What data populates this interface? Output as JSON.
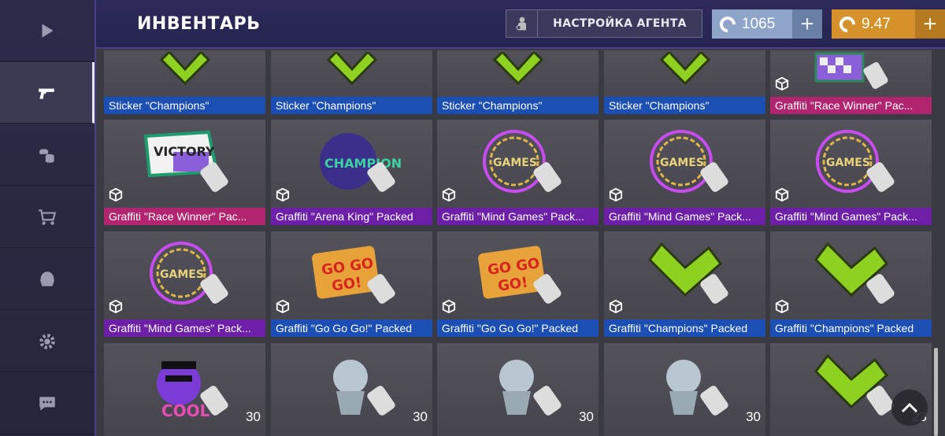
{
  "header": {
    "title": "ИНВЕНТАРЬ",
    "agent_button": "НАСТРОЙКА АГЕНТА",
    "credits": "1065",
    "gold": "9.47",
    "plus": "+"
  },
  "sidebar": {
    "items": [
      {
        "icon": "play-icon"
      },
      {
        "icon": "pistol-icon",
        "active": true
      },
      {
        "icon": "coins-icon"
      },
      {
        "icon": "cart-icon"
      },
      {
        "icon": "helmet-icon"
      },
      {
        "icon": "gear-icon"
      },
      {
        "icon": "chat-icon"
      }
    ]
  },
  "inventory": {
    "rows": [
      [
        {
          "label": "Sticker \"Champions\"",
          "color": "#1c4fb3"
        },
        {
          "label": "Sticker \"Champions\"",
          "color": "#1c4fb3"
        },
        {
          "label": "Sticker \"Champions\"",
          "color": "#1c4fb3"
        },
        {
          "label": "Sticker \"Champions\"",
          "color": "#1c4fb3"
        },
        {
          "label": "Graffiti \"Race Winner\" Pac...",
          "color": "#b1246f"
        }
      ],
      [
        {
          "label": "Graffiti \"Race Winner\" Pac...",
          "color": "#b1246f"
        },
        {
          "label": "Graffiti \"Arena King\" Packed",
          "color": "#6d1fa8"
        },
        {
          "label": "Graffiti \"Mind Games\" Pack...",
          "color": "#6d1fa8"
        },
        {
          "label": "Graffiti \"Mind Games\" Pack...",
          "color": "#6d1fa8"
        },
        {
          "label": "Graffiti \"Mind Games\" Pack...",
          "color": "#6d1fa8"
        }
      ],
      [
        {
          "label": "Graffiti \"Mind Games\" Pack...",
          "color": "#6d1fa8"
        },
        {
          "label": "Graffiti \"Go Go Go!\" Packed",
          "color": "#1c4fb3"
        },
        {
          "label": "Graffiti \"Go Go Go!\" Packed",
          "color": "#1c4fb3"
        },
        {
          "label": "Graffiti \"Champions\" Packed",
          "color": "#1c4fb3"
        },
        {
          "label": "Graffiti \"Champions\" Packed",
          "color": "#1c4fb3"
        }
      ],
      [
        {
          "count": "30"
        },
        {
          "count": "30"
        },
        {
          "count": "30"
        },
        {
          "count": "30"
        },
        {
          "count": "23"
        }
      ]
    ]
  },
  "up_button_icon": "chevron-up-icon"
}
